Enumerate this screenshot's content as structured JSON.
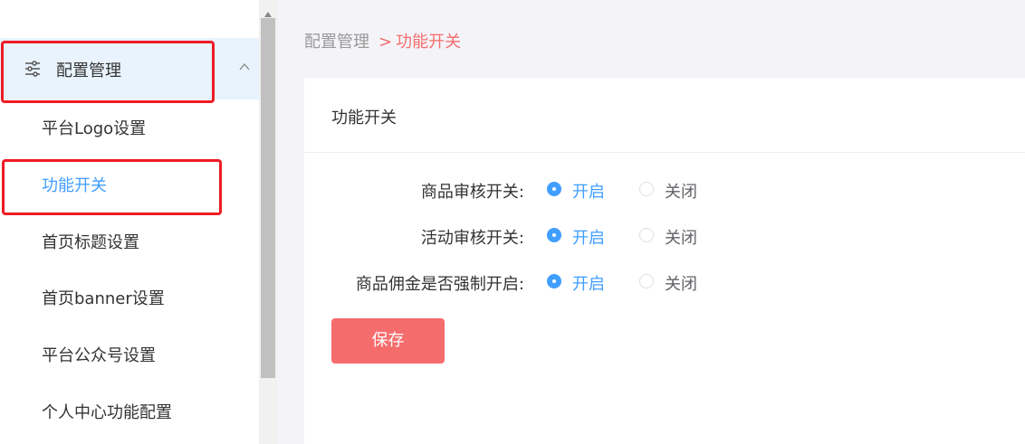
{
  "sidebar": {
    "parent": {
      "label": "配置管理",
      "icon": "sliders-icon",
      "expanded": true
    },
    "items": [
      {
        "label": "平台Logo设置",
        "active": false
      },
      {
        "label": "功能开关",
        "active": true
      },
      {
        "label": "首页标题设置",
        "active": false
      },
      {
        "label": "首页banner设置",
        "active": false
      },
      {
        "label": "平台公众号设置",
        "active": false
      },
      {
        "label": "个人中心功能配置",
        "active": false
      }
    ]
  },
  "breadcrumb": {
    "root": "配置管理",
    "separator": ">",
    "current": "功能开关"
  },
  "card": {
    "title": "功能开关",
    "rows": [
      {
        "label": "商品审核开关:",
        "options": [
          "开启",
          "关闭"
        ],
        "selected": "开启"
      },
      {
        "label": "活动审核开关:",
        "options": [
          "开启",
          "关闭"
        ],
        "selected": "开启"
      },
      {
        "label": "商品佣金是否强制开启:",
        "options": [
          "开启",
          "关闭"
        ],
        "selected": "开启"
      }
    ],
    "save_label": "保存"
  },
  "colors": {
    "accent": "#409eff",
    "danger": "#f56c6c",
    "highlight_box": "#ee1c25",
    "active_menu_bg": "#e8f3fd"
  }
}
